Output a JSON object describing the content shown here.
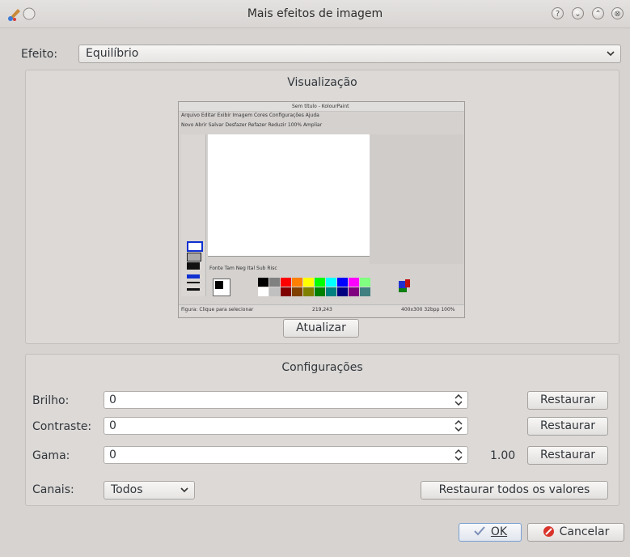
{
  "window": {
    "title": "Mais efeitos de imagem",
    "buttons": [
      "?",
      "⌄",
      "⌃",
      "⊗"
    ]
  },
  "effect": {
    "label": "Efeito:",
    "value": "Equilíbrio"
  },
  "preview": {
    "title": "Visualização",
    "refresh_label": "Atualizar",
    "thumb": {
      "title": "Sem título - KolourPaint",
      "menu": "Arquivo  Editar  Exibir  Imagem  Cores  Configurações  Ajuda",
      "toolbar": "Novo  Abrir  Salvar   Desfazer   Refazer   Reduzir   100%   Ampliar",
      "text_toolbar": "Fonte  Tam  Neg  Ital  Sub  Risc",
      "status_left": "Figura: Clique para selecionar",
      "status_mid": "219,243",
      "status_right": "400x300   32bpp   100%",
      "palette": [
        "#000000",
        "#808080",
        "#ff0000",
        "#ff8000",
        "#ffff00",
        "#00ff00",
        "#00ffff",
        "#0000ff",
        "#ff00ff",
        "#80ff80",
        "#ffffff",
        "#c0c0c0",
        "#800000",
        "#804000",
        "#808000",
        "#008000",
        "#008080",
        "#000080",
        "#800080",
        "#408080"
      ]
    }
  },
  "settings": {
    "title": "Configurações",
    "rows": [
      {
        "label": "Brilho:",
        "value": "0",
        "extra": "",
        "reset": "Restaurar"
      },
      {
        "label": "Contraste:",
        "value": "0",
        "extra": "",
        "reset": "Restaurar"
      },
      {
        "label": "Gama:",
        "value": "0",
        "extra": "1.00",
        "reset": "Restaurar"
      }
    ],
    "channels": {
      "label": "Canais:",
      "value": "Todos"
    },
    "reset_all": "Restaurar todos os valores"
  },
  "footer": {
    "ok": "OK",
    "cancel": "Cancelar"
  }
}
